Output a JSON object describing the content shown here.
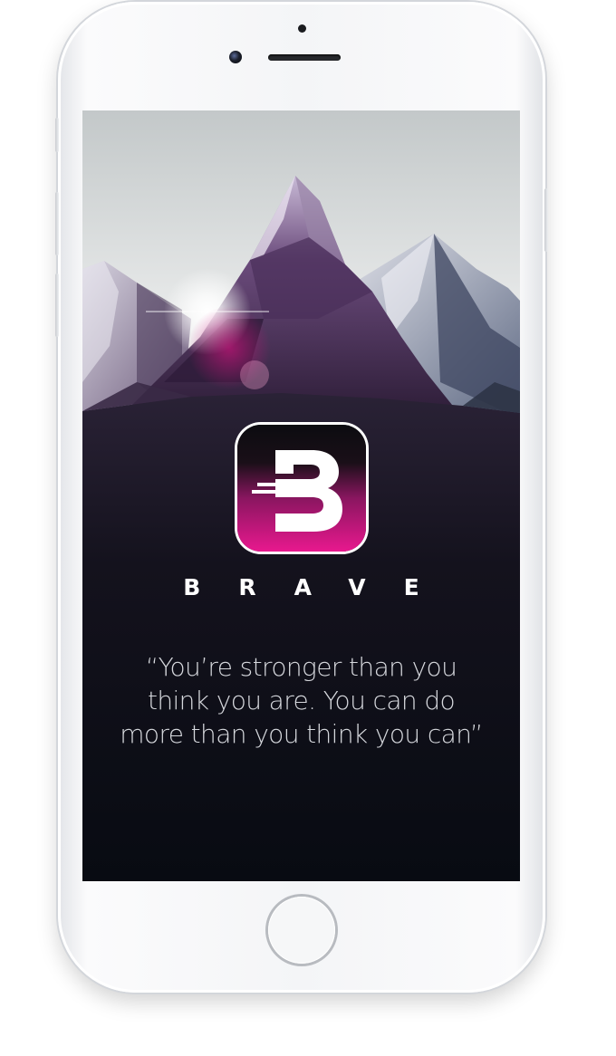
{
  "app": {
    "name": "BRAVE"
  },
  "logo": {
    "letter": "B",
    "gradient_top": "#0c0c10",
    "gradient_bottom": "#e8188e"
  },
  "quote": {
    "text": "“You’re stronger than you think you are. You can do more than you think you can”"
  },
  "colors": {
    "accent": "#e8188e",
    "screen_background": "#0b0e16",
    "text": "#ffffff"
  },
  "icons": {
    "home": "home-button-circle",
    "camera": "front-camera-dot",
    "speaker": "earpiece-slot"
  }
}
